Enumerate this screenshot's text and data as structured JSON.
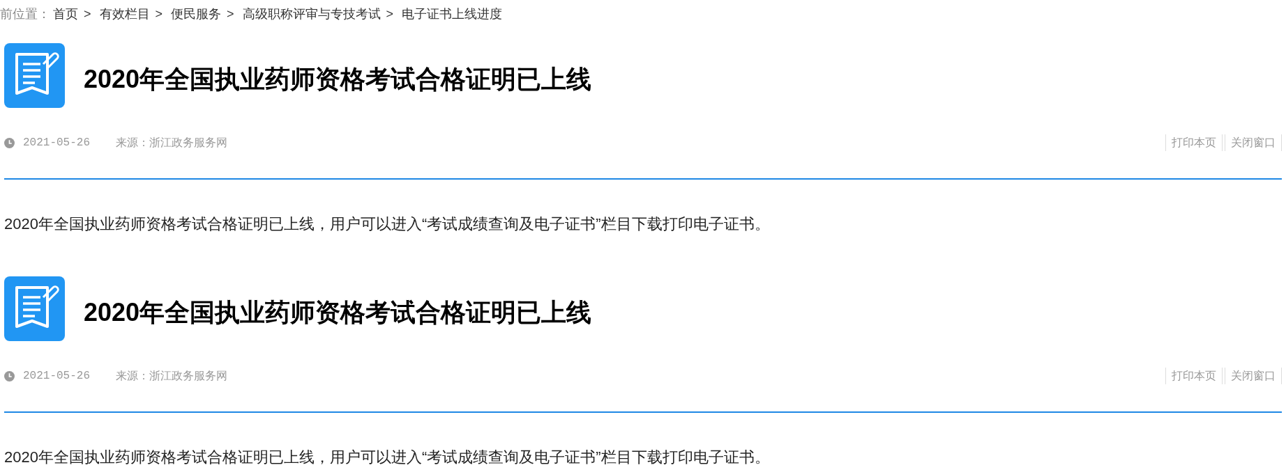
{
  "breadcrumb": {
    "label": "前位置：",
    "separator": ">",
    "items": [
      "首页",
      "有效栏目",
      "便民服务",
      "高级职称评审与专技考试",
      "电子证书上线进度"
    ]
  },
  "articles": [
    {
      "title": "2020年全国执业药师资格考试合格证明已上线",
      "date": "2021-05-26",
      "source": "来源：浙江政务服务网",
      "actions": [
        "打印本页",
        "关闭窗口"
      ],
      "body": "2020年全国执业药师资格考试合格证明已上线，用户可以进入“考试成绩查询及电子证书”栏目下载打印电子证书。"
    },
    {
      "title": "2020年全国执业药师资格考试合格证明已上线",
      "date": "2021-05-26",
      "source": "来源：浙江政务服务网",
      "actions": [
        "打印本页",
        "关闭窗口"
      ],
      "body": "2020年全国执业药师资格考试合格证明已上线，用户可以进入“考试成绩查询及电子证书”栏目下载打印电子证书。"
    }
  ]
}
